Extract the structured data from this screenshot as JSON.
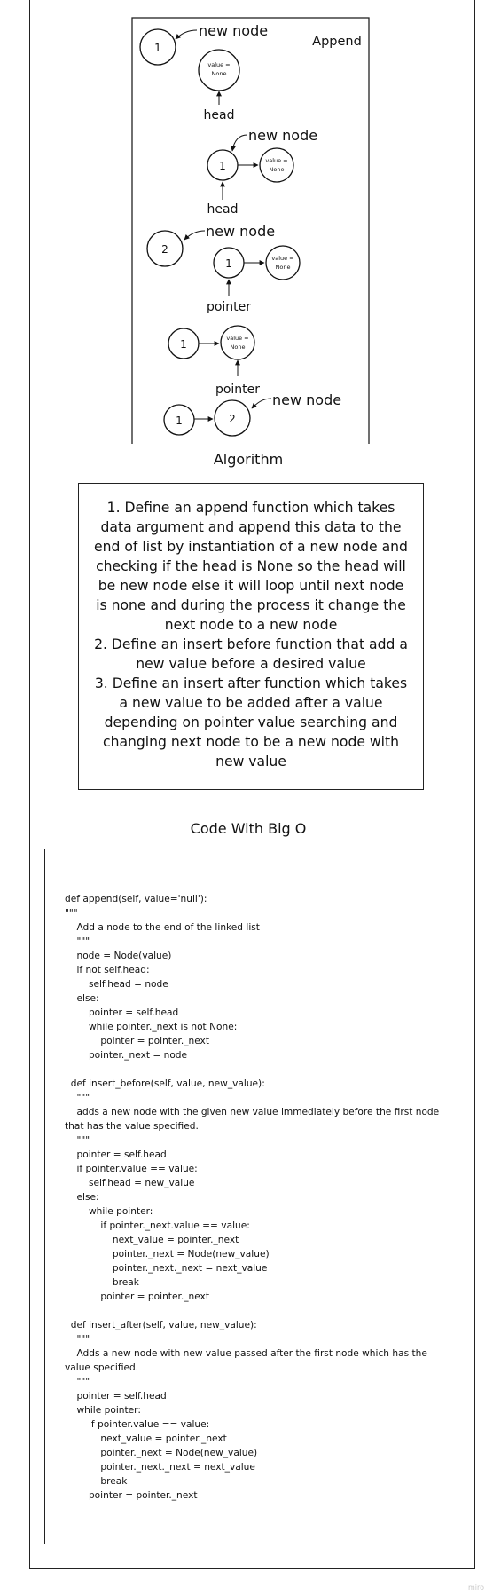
{
  "diagram": {
    "panel_title": "Append",
    "new_node_label": "new node",
    "head_label": "head",
    "pointer_label": "pointer",
    "value_none_line1": "value =",
    "value_none_line2": "None",
    "node_one": "1",
    "node_two": "2"
  },
  "algorithm": {
    "title": "Algorithm",
    "lines": [
      "1. Define an append function which takes data argument and append this data to the end of list by instantiation of a new node and checking if the head is None so the head will be new node else it will loop until next node is none and during the process it change the next node to a new node",
      "2. Define an insert before function that add a new value before a desired value",
      "3. Define an insert after function which takes a new value to be added after a value depending on pointer value searching and changing next node to be a new node with new value"
    ]
  },
  "code": {
    "title": "Code With Big O",
    "lines": [
      "def append(self, value='null'):",
      "\"\"\"",
      "    Add a node to the end of the linked list",
      "    \"\"\"",
      "    node = Node(value)",
      "    if not self.head:",
      "        self.head = node",
      "    else:",
      "        pointer = self.head",
      "        while pointer._next is not None:",
      "            pointer = pointer._next",
      "        pointer._next = node",
      "",
      "  def insert_before(self, value, new_value):",
      "    \"\"\"",
      "    adds a new node with the given new value immediately before the first node that has the value specified.",
      "    \"\"\"",
      "    pointer = self.head",
      "    if pointer.value == value:",
      "        self.head = new_value",
      "    else:",
      "        while pointer:",
      "            if pointer._next.value == value:",
      "                next_value = pointer._next",
      "                pointer._next = Node(new_value)",
      "                pointer._next._next = next_value",
      "                break",
      "            pointer = pointer._next",
      "",
      "  def insert_after(self, value, new_value):",
      "    \"\"\"",
      "    Adds a new node with new value passed after the first node which has the value specified.",
      "    \"\"\"",
      "    pointer = self.head",
      "    while pointer:",
      "        if pointer.value == value:",
      "            next_value = pointer._next",
      "            pointer._next = Node(new_value)",
      "            pointer._next._next = next_value",
      "            break",
      "        pointer = pointer._next"
    ]
  },
  "watermark": "miro"
}
